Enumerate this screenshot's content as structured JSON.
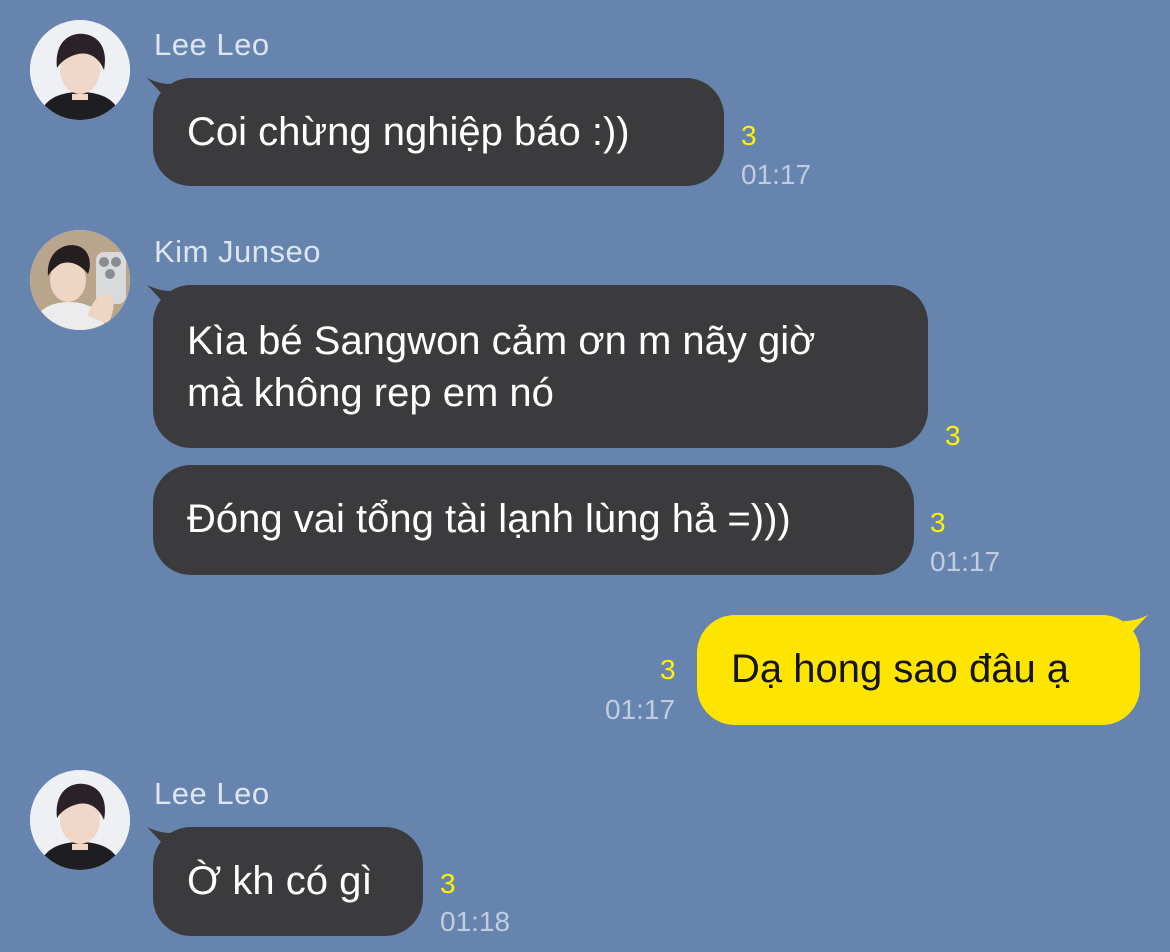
{
  "messages": [
    {
      "sender": "Lee Leo",
      "text": "Coi chừng nghiệp báo :))",
      "unread": "3",
      "time": "01:17"
    },
    {
      "sender": "Kim Junseo",
      "lines": [
        "Kìa bé Sangwon cảm ơn m nãy giờ",
        "mà không rep em nó"
      ],
      "unread": "3"
    },
    {
      "text": "Đóng vai tổng tài lạnh lùng hả =)))",
      "unread": "3",
      "time": "01:17"
    },
    {
      "text": "Dạ hong sao đâu ạ",
      "unread": "3",
      "time": "01:17"
    },
    {
      "sender": "Lee Leo",
      "text": "Ờ kh có gì",
      "unread": "3",
      "time": "01:18"
    }
  ],
  "colors": {
    "background": "#6684ad",
    "bubble_incoming": "#3b3b3d",
    "bubble_outgoing": "#fee500",
    "unread_count": "#fef200"
  }
}
